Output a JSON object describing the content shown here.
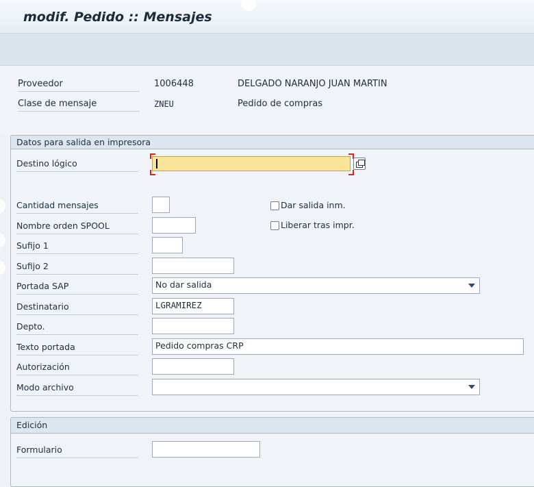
{
  "window": {
    "title": "modif. Pedido :: Mensajes"
  },
  "header": {
    "vendor_label": "Proveedor",
    "vendor_number": "1006448",
    "vendor_name": "DELGADO NARANJO JUAN MARTIN",
    "msgtype_label": "Clase de mensaje",
    "msgtype_code": "ZNEU",
    "msgtype_desc": "Pedido de compras"
  },
  "print_group": {
    "title": "Datos para salida en impresora",
    "logical_dest": {
      "label": "Destino lógico",
      "value": ""
    },
    "num_messages": {
      "label": "Cantidad mensajes",
      "value": ""
    },
    "spool_name": {
      "label": "Nombre orden SPOOL",
      "value": ""
    },
    "suffix1": {
      "label": "Sufijo 1",
      "value": ""
    },
    "suffix2": {
      "label": "Sufijo 2",
      "value": ""
    },
    "sap_cover": {
      "label": "Portada SAP",
      "value": "No dar salida"
    },
    "recipient": {
      "label": "Destinatario",
      "value": "LGRAMIREZ"
    },
    "department": {
      "label": "Depto.",
      "value": ""
    },
    "cover_text": {
      "label": "Texto portada",
      "value": "Pedido compras CRP"
    },
    "authorization": {
      "label": "Autorización",
      "value": ""
    },
    "archive_mode": {
      "label": "Modo archivo",
      "value": ""
    },
    "print_immediately": {
      "label": "Dar salida inm.",
      "checked": false
    },
    "release_after_print": {
      "label": "Liberar tras impr.",
      "checked": false
    }
  },
  "edition_group": {
    "title": "Edición",
    "form": {
      "label": "Formulario",
      "value": ""
    }
  },
  "icons": {
    "value_help": "value-help-icon",
    "dropdown": "chevron-down-icon"
  },
  "colors": {
    "focus_field": "#fae49a",
    "group_header": "#dde6ef",
    "background": "#eef2f7"
  }
}
